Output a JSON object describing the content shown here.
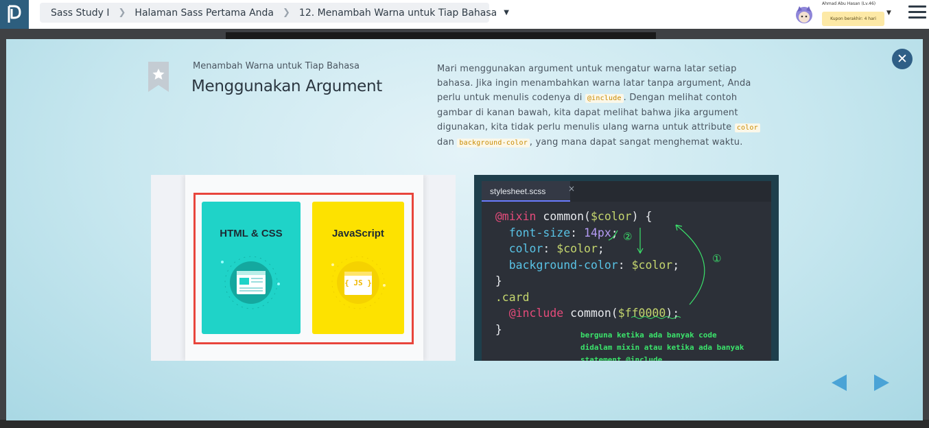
{
  "breadcrumb": {
    "course": "Sass Study I",
    "section": "Halaman Sass Pertama Anda",
    "lesson": "12. Menambah Warna untuk Tiap Bahasa"
  },
  "user": {
    "name": "Ahmad Abu Hasan (Lv.46)",
    "coupon": "Kupon berakhir: 4 hari"
  },
  "slide": {
    "subtitle": "Menambah Warna untuk Tiap Bahasa",
    "title": "Menggunakan Argument",
    "desc_1": "Mari menggunakan argument untuk mengatur warna latar setiap bahasa. Jika ingin menambahkan warna latar tanpa argument, Anda perlu untuk menulis codenya di ",
    "code_include": "@include",
    "desc_2": ". Dengan melihat contoh gambar di kanan bawah, kita dapat melihat bahwa jika argument digunakan, kita tidak perlu menulis ulang warna untuk attribute ",
    "code_color": "color",
    "desc_3": " dan ",
    "code_bgcolor": "background-color",
    "desc_4": ", yang mana dapat sangat menghemat waktu."
  },
  "left_image": {
    "card1_label": "HTML & CSS",
    "card2_label": "JavaScript",
    "badge_js": "{ JS }"
  },
  "editor": {
    "tab_name": "stylesheet.scss",
    "tab_close": "×",
    "annot_1": "①",
    "annot_2": "②",
    "note": "berguna ketika ada banyak code\ndidalam mixin atau ketika ada banyak\nstatement @include"
  },
  "colors": {
    "accent": "#2f5f86",
    "teal": "#1fd3c8",
    "yellow": "#fde200",
    "red": "#e8453c"
  }
}
